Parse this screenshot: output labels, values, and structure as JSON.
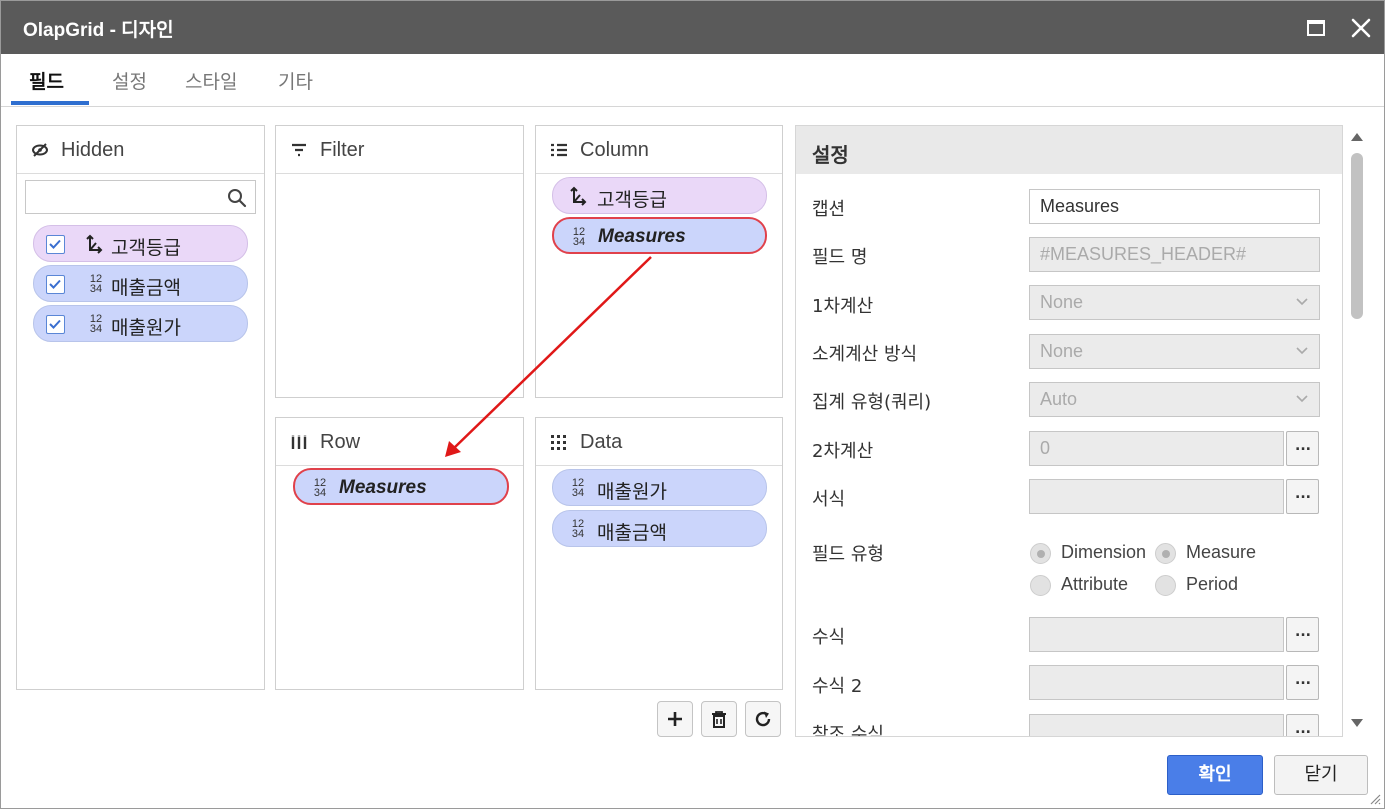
{
  "window": {
    "title": "OlapGrid - 디자인"
  },
  "tabs": [
    {
      "label": "필드",
      "active": true
    },
    {
      "label": "설정",
      "active": false
    },
    {
      "label": "스타일",
      "active": false
    },
    {
      "label": "기타",
      "active": false
    }
  ],
  "panels": {
    "hidden": {
      "title": "Hidden",
      "search_value": "",
      "items": [
        {
          "label": "고객등급",
          "kind": "dimension",
          "checked": true
        },
        {
          "label": "매출금액",
          "kind": "measure",
          "checked": true
        },
        {
          "label": "매출원가",
          "kind": "measure",
          "checked": true
        }
      ]
    },
    "filter": {
      "title": "Filter",
      "items": []
    },
    "column": {
      "title": "Column",
      "items": [
        {
          "label": "고객등급",
          "kind": "dimension"
        },
        {
          "label": "Measures",
          "kind": "measure",
          "selected": true
        }
      ]
    },
    "row": {
      "title": "Row",
      "items": [
        {
          "label": "Measures",
          "kind": "measure",
          "selected": true
        }
      ]
    },
    "data": {
      "title": "Data",
      "items": [
        {
          "label": "매출원가",
          "kind": "measure"
        },
        {
          "label": "매출금액",
          "kind": "measure"
        }
      ]
    }
  },
  "numeric_icon": {
    "top": "12",
    "bottom": "34"
  },
  "settings": {
    "title": "설정",
    "caption": {
      "label": "캡션",
      "value": "Measures"
    },
    "field_name": {
      "label": "필드 명",
      "value": "#MEASURES_HEADER#"
    },
    "first_calc": {
      "label": "1차계산",
      "value": "None"
    },
    "subtotal_method": {
      "label": "소계계산 방식",
      "value": "None"
    },
    "aggregation_type": {
      "label": "집계 유형(쿼리)",
      "value": "Auto"
    },
    "second_calc": {
      "label": "2차계산",
      "value": "0"
    },
    "format": {
      "label": "서식",
      "value": ""
    },
    "field_type": {
      "label": "필드 유형",
      "options": [
        {
          "label": "Dimension",
          "checked": true
        },
        {
          "label": "Measure",
          "checked": true
        },
        {
          "label": "Attribute",
          "checked": false
        },
        {
          "label": "Period",
          "checked": false
        }
      ]
    },
    "formula": {
      "label": "수식",
      "value": ""
    },
    "formula2": {
      "label": "수식 2",
      "value": ""
    },
    "ref_formula": {
      "label": "참조 수식",
      "value": ""
    },
    "ellipsis": "..."
  },
  "footer": {
    "ok_label": "확인",
    "close_label": "닫기"
  },
  "colors": {
    "titlebar": "#5a5a5a",
    "tab_accent": "#2f6fd0",
    "measure_chip": "#cbd5fb",
    "dimension_chip": "#ead8f8",
    "selected_border": "#e0414b",
    "ok_button": "#4a7ee8",
    "drag_arrow": "#e01818"
  },
  "icons": {
    "hidden_panel": "eye-slash-icon",
    "filter_panel": "filter-icon",
    "column_panel": "list-icon",
    "row_panel": "columns-icon",
    "data_panel": "grid-dots-icon",
    "dimension": "hierarchy-icon",
    "measure": "numeric-icon",
    "toolbar": [
      "plus-icon",
      "trash-icon",
      "refresh-icon"
    ]
  }
}
